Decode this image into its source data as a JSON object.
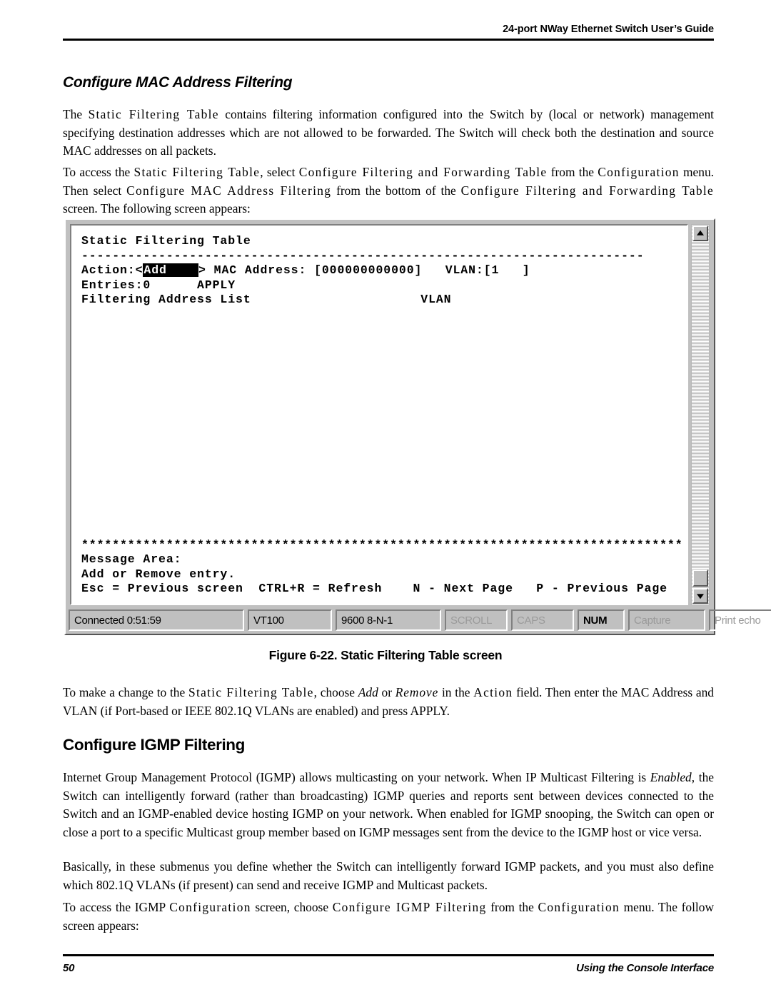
{
  "header": {
    "title": "24-port NWay Ethernet Switch User’s Guide"
  },
  "headings": {
    "mac_filtering": "Configure MAC Address Filtering",
    "igmp_filtering": "Configure IGMP Filtering"
  },
  "paragraphs": {
    "p1_a": "The ",
    "p1_b": "Static Filtering Table",
    "p1_c": " contains filtering information configured into the Switch by (local or network) management specifying destination addresses which are not allowed to be forwarded. The Switch will check both the destination and source MAC addresses on all packets.",
    "p2_a": "To access the ",
    "p2_b": "Static Filtering Table",
    "p2_c": ", select ",
    "p2_d": "Configure Filtering and Forwarding Table",
    "p2_e": " from the ",
    "p2_f": "Configuration",
    "p2_g": " menu. Then select ",
    "p2_h": "Configure MAC Address Filtering",
    "p2_i": " from the bottom of the ",
    "p2_j": "Configure Filtering and Forwarding Table",
    "p2_k": " screen. The following screen appears:",
    "p3_a": "To make a change to the ",
    "p3_b": "Static Filtering Table",
    "p3_c": ", choose ",
    "p3_d": "Add",
    "p3_e": " or ",
    "p3_f": "Remove",
    "p3_g": " in the ",
    "p3_h": "Action",
    "p3_i": " field. Then enter the MAC Address and VLAN (if Port-based or IEEE 802.1Q VLANs are enabled) and press APPLY.",
    "p4_a": "Internet Group Management Protocol (IGMP) allows multicasting on your network. When IP Multicast Filtering is ",
    "p4_b": "Enabled",
    "p4_c": ", the Switch can intelligently forward (rather than broadcasting) IGMP queries and reports sent between devices connected to the Switch and an IGMP-enabled device hosting IGMP on your network. When enabled for IGMP snooping, the Switch can open or close a port to a specific Multicast group member based on IGMP messages sent from the device to the IGMP host or vice versa.",
    "p5": "Basically, in these submenus you define whether the Switch can intelligently forward IGMP packets, and you must also define which 802.1Q VLANs (if present) can send and receive IGMP and Multicast packets.",
    "p6_a": "To access the IGMP ",
    "p6_b": "Configuration",
    "p6_c": " screen, choose ",
    "p6_d": "Configure IGMP Filtering",
    "p6_e": " from the ",
    "p6_f": "Configuration",
    "p6_g": " menu. The follow screen appears:"
  },
  "terminal": {
    "title": "Static Filtering Table",
    "divider": "-------------------------------------------------------------------------",
    "action_label": "Action:<",
    "action_value": "Add",
    "action_pad": "    ",
    "action_close": "> MAC Address: [000000000000]   VLAN:[1   ]",
    "entries_line": "Entries:0      APPLY",
    "list_line": "Filtering Address List                      VLAN",
    "starline": "********************************************************************************************",
    "message_label": "Message Area:",
    "message_text": "Add or Remove entry.",
    "keys_line": "Esc = Previous screen  CTRL+R = Refresh    N - Next Page   P - Previous Page",
    "status": {
      "connected": "Connected 0:51:59",
      "emulation": "VT100",
      "baud": "9600 8-N-1",
      "scroll": "SCROLL",
      "caps": "CAPS",
      "num": "NUM",
      "capture": "Capture",
      "print_echo": "Print echo"
    }
  },
  "figure": {
    "caption": "Figure 6-22.  Static Filtering Table screen"
  },
  "footer": {
    "page_number": "50",
    "section": "Using the Console Interface"
  }
}
